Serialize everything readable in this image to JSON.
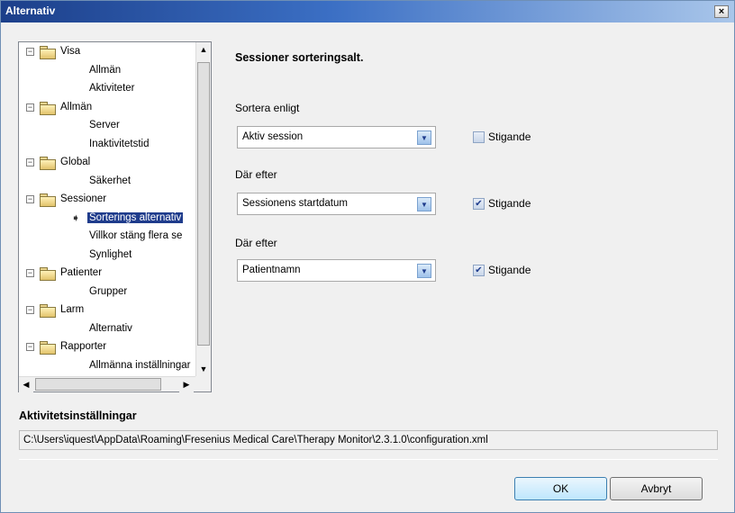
{
  "window": {
    "title": "Alternativ",
    "close_label": "×"
  },
  "tree": {
    "items": [
      {
        "label": "Visa",
        "level": 0,
        "expander": "⊟"
      },
      {
        "label": "Allmän",
        "level": 1
      },
      {
        "label": "Aktiviteter",
        "level": 1
      },
      {
        "label": "Allmän",
        "level": 0,
        "expander": "⊟"
      },
      {
        "label": "Server",
        "level": 1
      },
      {
        "label": "Inaktivitetstid",
        "level": 1
      },
      {
        "label": "Global",
        "level": 0,
        "expander": "⊟"
      },
      {
        "label": "Säkerhet",
        "level": 1
      },
      {
        "label": "Sessioner",
        "level": 0,
        "expander": "⊟"
      },
      {
        "label": "Sorterings alternativ",
        "level": 1,
        "selected": true
      },
      {
        "label": "Villkor stäng flera se",
        "level": 1
      },
      {
        "label": "Synlighet",
        "level": 1
      },
      {
        "label": "Patienter",
        "level": 0,
        "expander": "⊟"
      },
      {
        "label": "Grupper",
        "level": 1
      },
      {
        "label": "Larm",
        "level": 0,
        "expander": "⊟"
      },
      {
        "label": "Alternativ",
        "level": 1
      },
      {
        "label": "Rapporter",
        "level": 0,
        "expander": "⊟"
      },
      {
        "label": "Allmänna inställningar",
        "level": 1
      }
    ],
    "scroll_up": "▲",
    "scroll_down": "▼",
    "scroll_left": "◀",
    "scroll_right": "▶",
    "selected_marker": "➧"
  },
  "main": {
    "heading": "Sessioner sorteringsalt.",
    "sort_label": "Sortera enligt",
    "then_label_1": "Där efter",
    "then_label_2": "Där efter",
    "combos": [
      {
        "value": "Aktiv session",
        "checked": false,
        "check_label": "Stigande"
      },
      {
        "value": "Sessionens startdatum",
        "checked": true,
        "check_label": "Stigande"
      },
      {
        "value": "Patientnamn",
        "checked": true,
        "check_label": "Stigande"
      }
    ],
    "dropdown_glyph": "▼",
    "check_glyph": "✔"
  },
  "activity": {
    "title": "Aktivitetsinställningar",
    "path": "C:\\Users\\iquest\\AppData\\Roaming\\Fresenius Medical Care\\Therapy Monitor\\2.3.1.0\\configuration.xml"
  },
  "buttons": {
    "ok": "OK",
    "cancel": "Avbryt"
  }
}
